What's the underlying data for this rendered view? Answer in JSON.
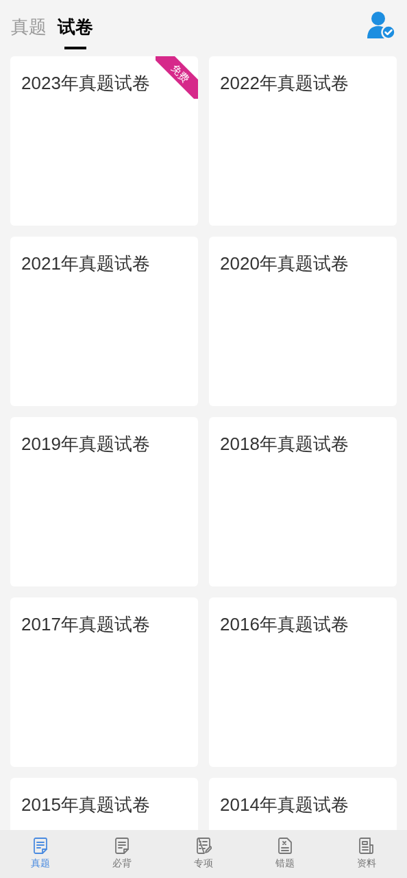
{
  "tabs": [
    {
      "label": "真题",
      "selected": false
    },
    {
      "label": "试卷",
      "selected": true
    }
  ],
  "papers": [
    {
      "title": "2023年真题试卷",
      "badge": "免费"
    },
    {
      "title": "2022年真题试卷"
    },
    {
      "title": "2021年真题试卷"
    },
    {
      "title": "2020年真题试卷"
    },
    {
      "title": "2019年真题试卷"
    },
    {
      "title": "2018年真题试卷"
    },
    {
      "title": "2017年真题试卷"
    },
    {
      "title": "2016年真题试卷"
    },
    {
      "title": "2015年真题试卷"
    },
    {
      "title": "2014年真题试卷"
    }
  ],
  "bottom_nav": [
    {
      "label": "真题",
      "kind": "document",
      "selected": true
    },
    {
      "label": "必背",
      "kind": "document",
      "selected": false
    },
    {
      "label": "专项",
      "kind": "checklist",
      "selected": false
    },
    {
      "label": "错题",
      "kind": "wrong",
      "selected": false
    },
    {
      "label": "资料",
      "kind": "newspaper",
      "selected": false
    }
  ]
}
